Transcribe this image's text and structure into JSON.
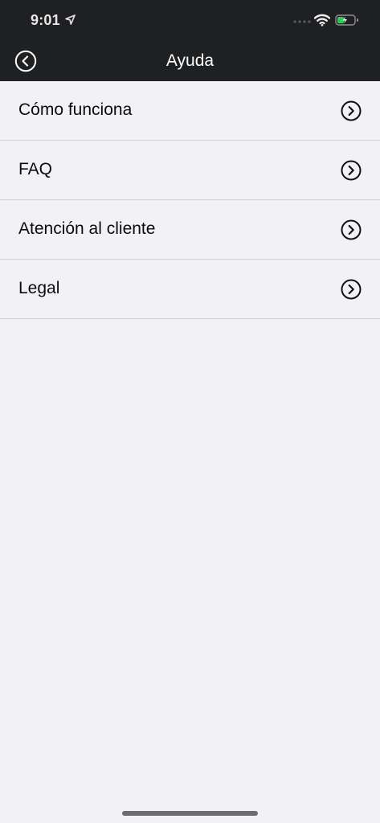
{
  "status_bar": {
    "time": "9:01",
    "icons": [
      "location-arrow-icon",
      "signal-dots-icon",
      "wifi-icon",
      "battery-charging-icon"
    ],
    "battery_color": "#34c759"
  },
  "header": {
    "title": "Ayuda",
    "back_icon": "chevron-left-circle-icon",
    "background": "#1f2022"
  },
  "menu": {
    "items": [
      {
        "label": "Cómo funciona",
        "icon": "chevron-right-circle-icon"
      },
      {
        "label": "FAQ",
        "icon": "chevron-right-circle-icon"
      },
      {
        "label": "Atención al cliente",
        "icon": "chevron-right-circle-icon"
      },
      {
        "label": "Legal",
        "icon": "chevron-right-circle-icon"
      }
    ]
  },
  "colors": {
    "page_background": "#f2f1f6",
    "divider": "#d1d1d6",
    "text": "#0c0c0c"
  }
}
